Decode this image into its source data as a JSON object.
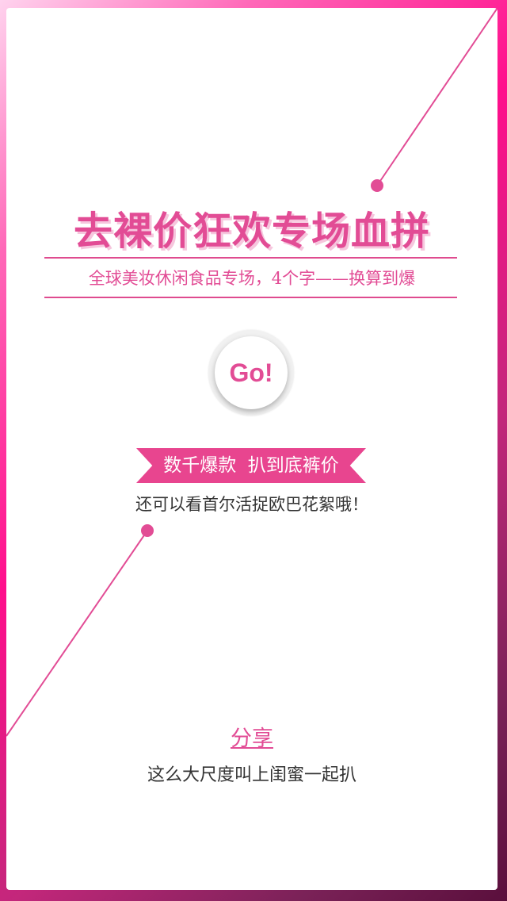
{
  "hero": {
    "title": "去裸价狂欢专场血拼",
    "subtitle": "全球美妆休闲食品专场，4个字——换算到爆"
  },
  "go_button": {
    "label": "Go!"
  },
  "promo": {
    "ribbon": "数千爆款  扒到底裤价",
    "text": "还可以看首尔活捉欧巴花絮哦！"
  },
  "share": {
    "label": "分享",
    "note": "这么大尺度叫上闺蜜一起扒"
  },
  "colors": {
    "accent_pink": "#e24c95",
    "ribbon_pink": "#e8458f",
    "text_dark": "#333333",
    "background": "#ffffff"
  }
}
